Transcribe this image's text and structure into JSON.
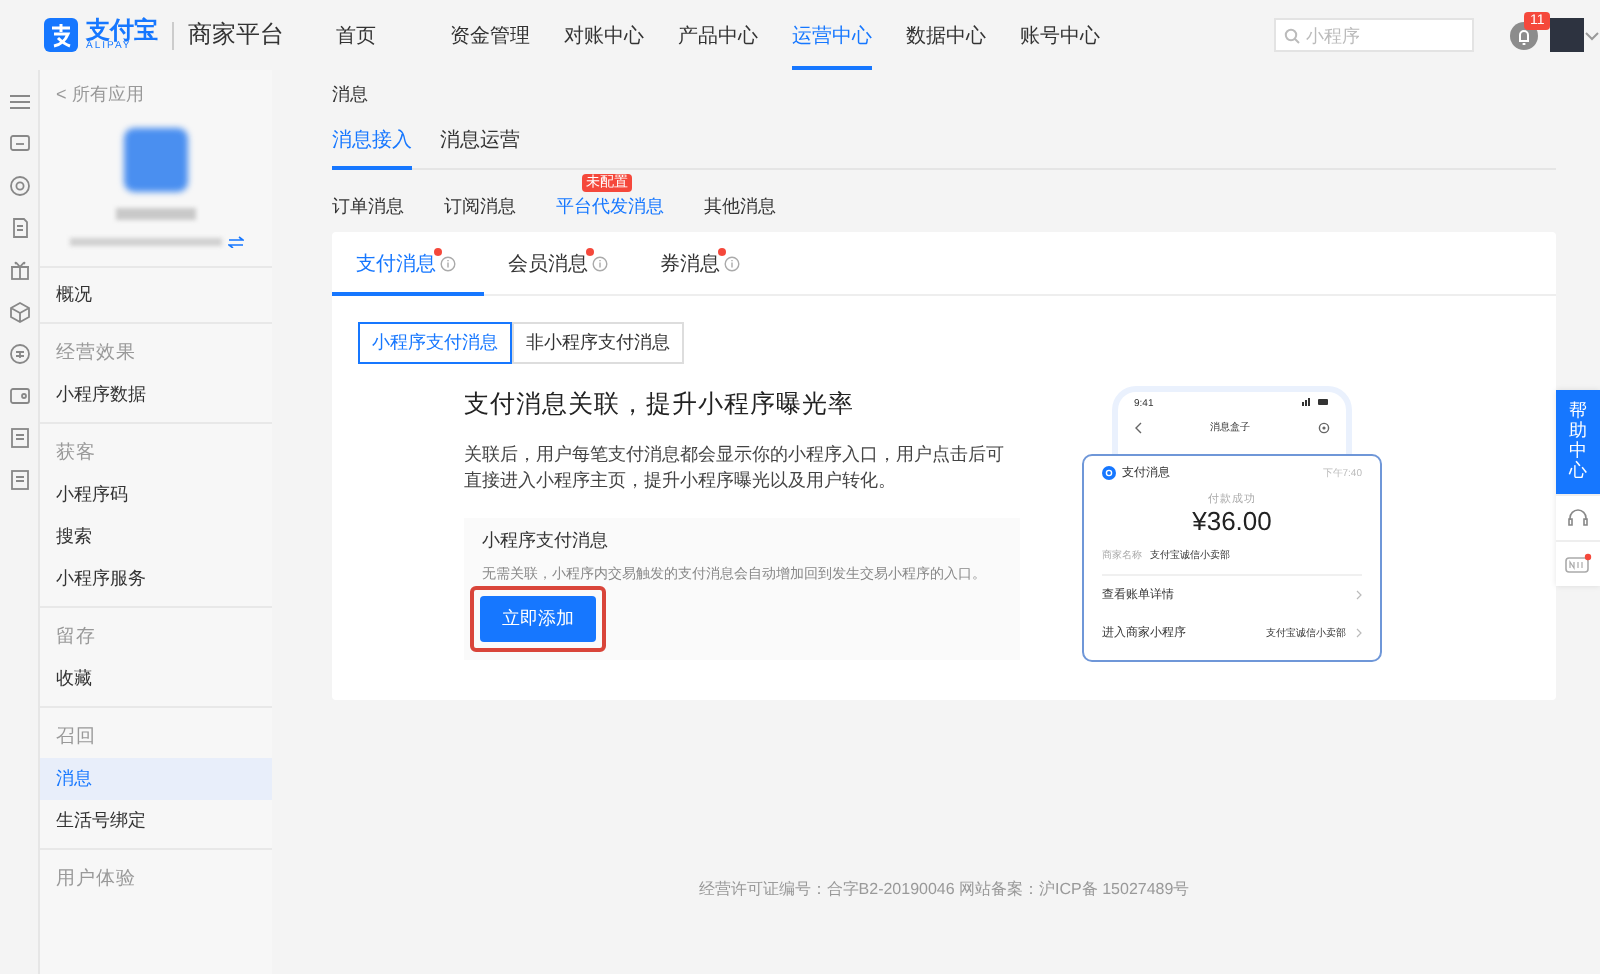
{
  "header": {
    "logo_text": "支付宝",
    "logo_subtext": "ALIPAY",
    "platform": "商家平台",
    "nav": [
      {
        "label": "首页",
        "selected": false
      },
      {
        "label": "资金管理",
        "selected": false
      },
      {
        "label": "对账中心",
        "selected": false
      },
      {
        "label": "产品中心",
        "selected": false
      },
      {
        "label": "运营中心",
        "selected": true
      },
      {
        "label": "数据中心",
        "selected": false
      },
      {
        "label": "账号中心",
        "selected": false
      }
    ],
    "search": {
      "placeholder": "小程序"
    },
    "notification_count": "11"
  },
  "sidebar": {
    "back_link": "< 所有应用",
    "groups": [
      {
        "items": [
          {
            "label": "概况",
            "selected": false
          }
        ]
      },
      {
        "heading": "经营效果",
        "items": [
          {
            "label": "小程序数据",
            "selected": false
          }
        ]
      },
      {
        "heading": "获客",
        "items": [
          {
            "label": "小程序码",
            "selected": false
          },
          {
            "label": "搜索",
            "selected": false
          },
          {
            "label": "小程序服务",
            "selected": false
          }
        ]
      },
      {
        "heading": "留存",
        "items": [
          {
            "label": "收藏",
            "selected": false
          }
        ]
      },
      {
        "heading": "召回",
        "items": [
          {
            "label": "消息",
            "selected": true
          },
          {
            "label": "生活号绑定",
            "selected": false
          }
        ]
      },
      {
        "heading": "用户体验"
      }
    ]
  },
  "breadcrumb": "消息",
  "tabs": [
    {
      "label": "消息接入",
      "selected": true
    },
    {
      "label": "消息运营",
      "selected": false
    }
  ],
  "sub_tabs": [
    {
      "label": "订单消息",
      "selected": false
    },
    {
      "label": "订阅消息",
      "selected": false
    },
    {
      "label": "平台代发消息",
      "selected": true,
      "badge": "未配置"
    },
    {
      "label": "其他消息",
      "selected": false
    }
  ],
  "card": {
    "tabs": [
      {
        "label": "支付消息",
        "selected": true,
        "dot": true
      },
      {
        "label": "会员消息",
        "selected": false,
        "dot": true
      },
      {
        "label": "券消息",
        "selected": false,
        "dot": true
      }
    ],
    "segments": [
      {
        "label": "小程序支付消息",
        "selected": true
      },
      {
        "label": "非小程序支付消息",
        "selected": false
      }
    ],
    "title": "支付消息关联，提升小程序曝光率",
    "description": "关联后，用户每笔支付消息都会显示你的小程序入口，用户点击后可直接进入小程序主页，提升小程序曝光以及用户转化。",
    "option": {
      "title": "小程序支付消息",
      "text": "无需关联，小程序内交易触发的支付消息会自动增加回到发生交易小程序的入口。",
      "button": "立即添加",
      "highlighted": true
    },
    "preview": {
      "time": "9:41",
      "title": "消息盒子",
      "message_title": "支付消息",
      "message_time": "下午7:40",
      "status": "付款成功",
      "amount": "¥36.00",
      "merchant_label": "商家名称",
      "merchant": "支付宝诚信小卖部",
      "rows": [
        {
          "label": "查看账单详情"
        },
        {
          "label": "进入商家小程序",
          "value": "支付宝诚信小卖部"
        }
      ]
    }
  },
  "help": {
    "label": "帮助中心"
  },
  "footer": "经营许可证编号：合字B2-20190046 网站备案：沪ICP备 15027489号"
}
